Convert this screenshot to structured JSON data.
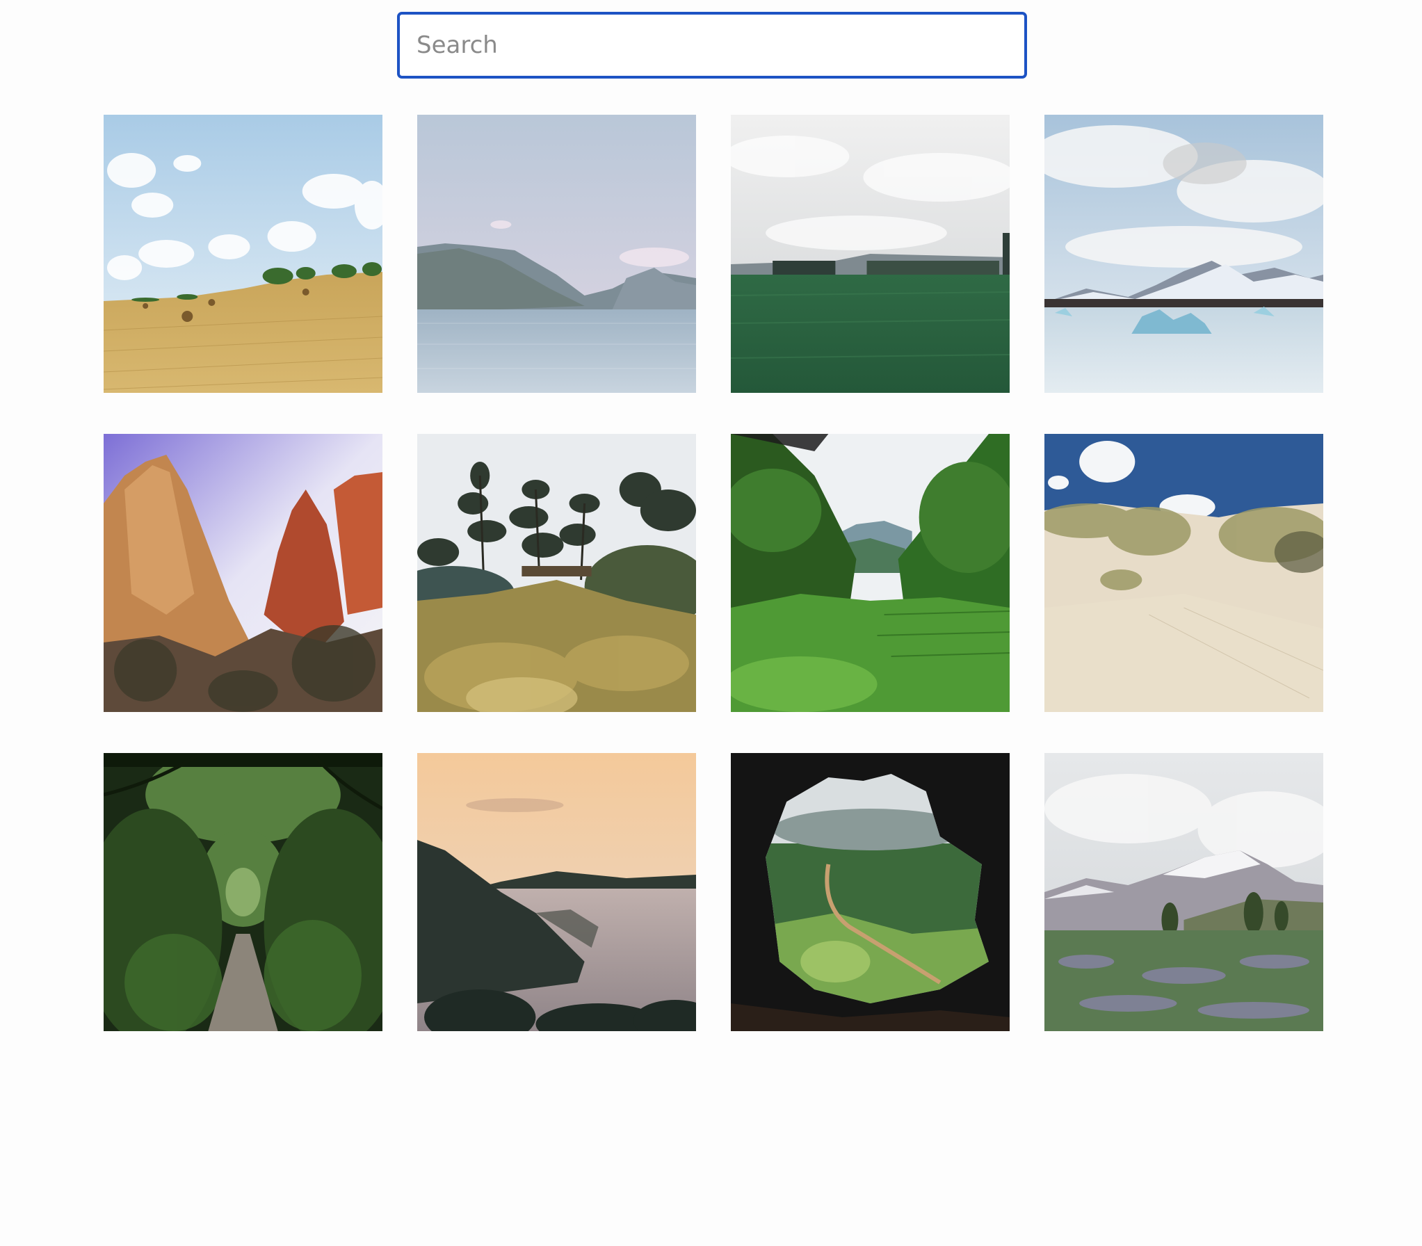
{
  "search": {
    "placeholder": "Search",
    "value": ""
  },
  "gallery": {
    "images": [
      {
        "scene": "hay-field-under-cloudy-sky"
      },
      {
        "scene": "misty-lake-with-mountains"
      },
      {
        "scene": "green-meadow-overcast"
      },
      {
        "scene": "glacier-lagoon-icebergs"
      },
      {
        "scene": "red-rock-canyon-cliffs"
      },
      {
        "scene": "garden-with-pine-trees"
      },
      {
        "scene": "green-valley-through-trees"
      },
      {
        "scene": "sand-dunes-with-grass"
      },
      {
        "scene": "forest-path-tunnel"
      },
      {
        "scene": "coastal-cliffs-at-sunset"
      },
      {
        "scene": "valley-view-from-cave"
      },
      {
        "scene": "lupine-field-snowy-mountain"
      }
    ]
  }
}
